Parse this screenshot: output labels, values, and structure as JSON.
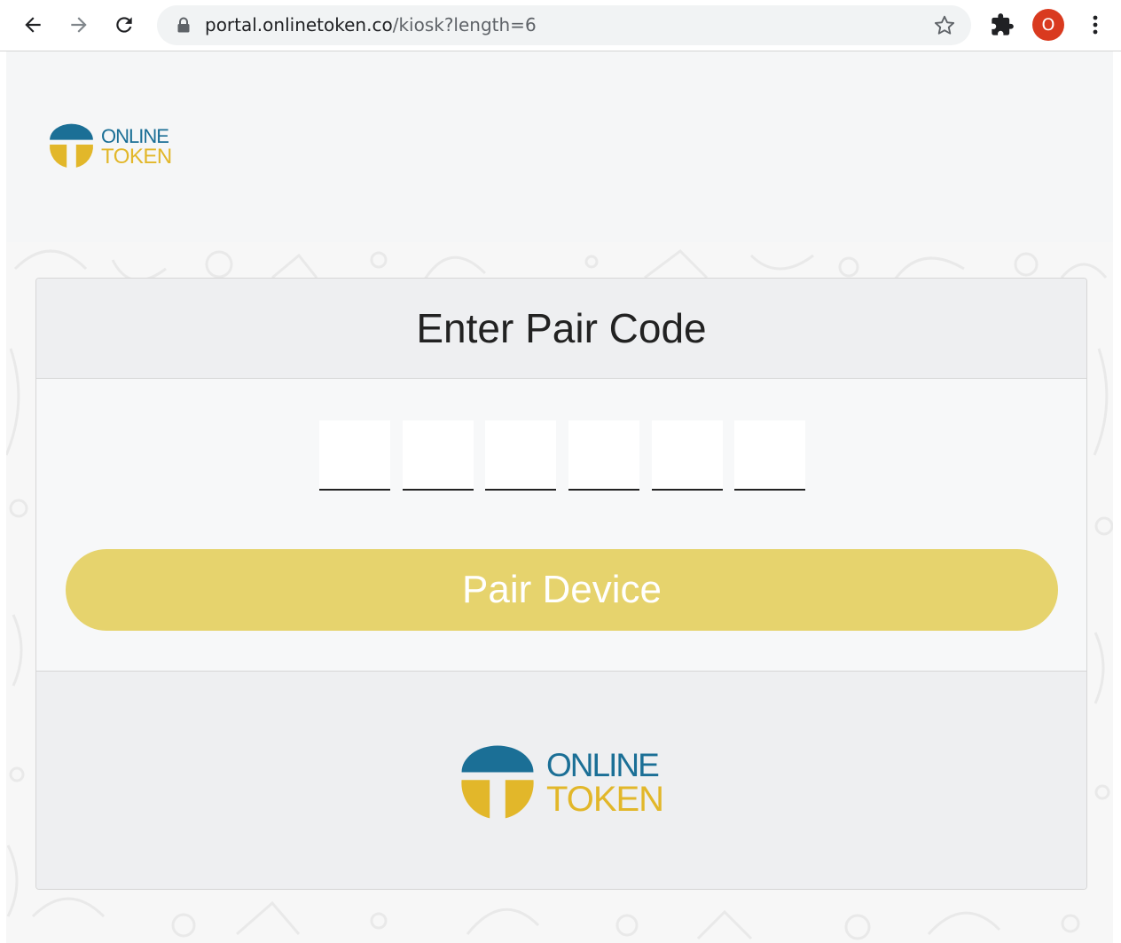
{
  "browser": {
    "url_host": "portal.onlinetoken.co",
    "url_path": "/kiosk?length=6",
    "profile_initial": "O",
    "profile_color": "#d93a1f",
    "icons": [
      "back-arrow-icon",
      "forward-arrow-icon",
      "reload-icon",
      "lock-icon",
      "star-icon",
      "extensions-puzzle-icon",
      "more-vert-icon"
    ]
  },
  "brand": {
    "word1": "ONLINE",
    "word2": "TOKEN",
    "blue": "#1b6f96",
    "yellow": "#e2b72a"
  },
  "pair": {
    "title": "Enter Pair Code",
    "code_length": 6,
    "code_digits": [
      "",
      "",
      "",
      "",
      "",
      ""
    ],
    "button_label": "Pair Device",
    "button_color": "#e6d36d"
  }
}
